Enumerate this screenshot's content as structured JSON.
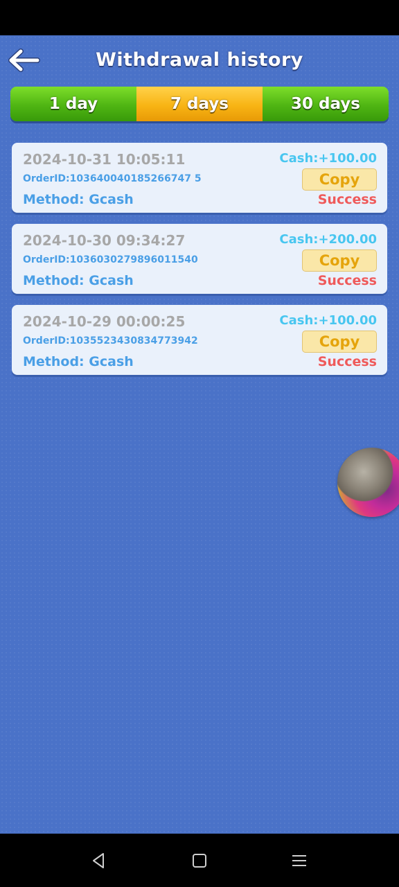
{
  "header": {
    "title": "Withdrawal history"
  },
  "tabs": [
    {
      "label": "1 day",
      "active": false
    },
    {
      "label": "7 days",
      "active": true
    },
    {
      "label": "30 days",
      "active": false
    }
  ],
  "records": [
    {
      "datetime": "2024-10-31 10:05:11",
      "order_id": "OrderID:103640040185266747 5",
      "method": "Method: Gcash",
      "cash": "Cash:+100.00",
      "copy_label": "Copy",
      "status": "Success"
    },
    {
      "datetime": "2024-10-30 09:34:27",
      "order_id": "OrderID:1036030279896011540",
      "method": "Method: Gcash",
      "cash": "Cash:+200.00",
      "copy_label": "Copy",
      "status": "Success"
    },
    {
      "datetime": "2024-10-29 00:00:25",
      "order_id": "OrderID:1035523430834773942",
      "method": "Method: Gcash",
      "cash": "Cash:+100.00",
      "copy_label": "Copy",
      "status": "Success"
    }
  ],
  "icons": {
    "back": "back-arrow-icon",
    "float": "floating-avatar-icon"
  },
  "colors": {
    "background": "#4a72c8",
    "tab_green": "#4fb513",
    "tab_active": "#f8b414",
    "status_success": "#ef5a5a",
    "cash": "#48c6f0"
  }
}
